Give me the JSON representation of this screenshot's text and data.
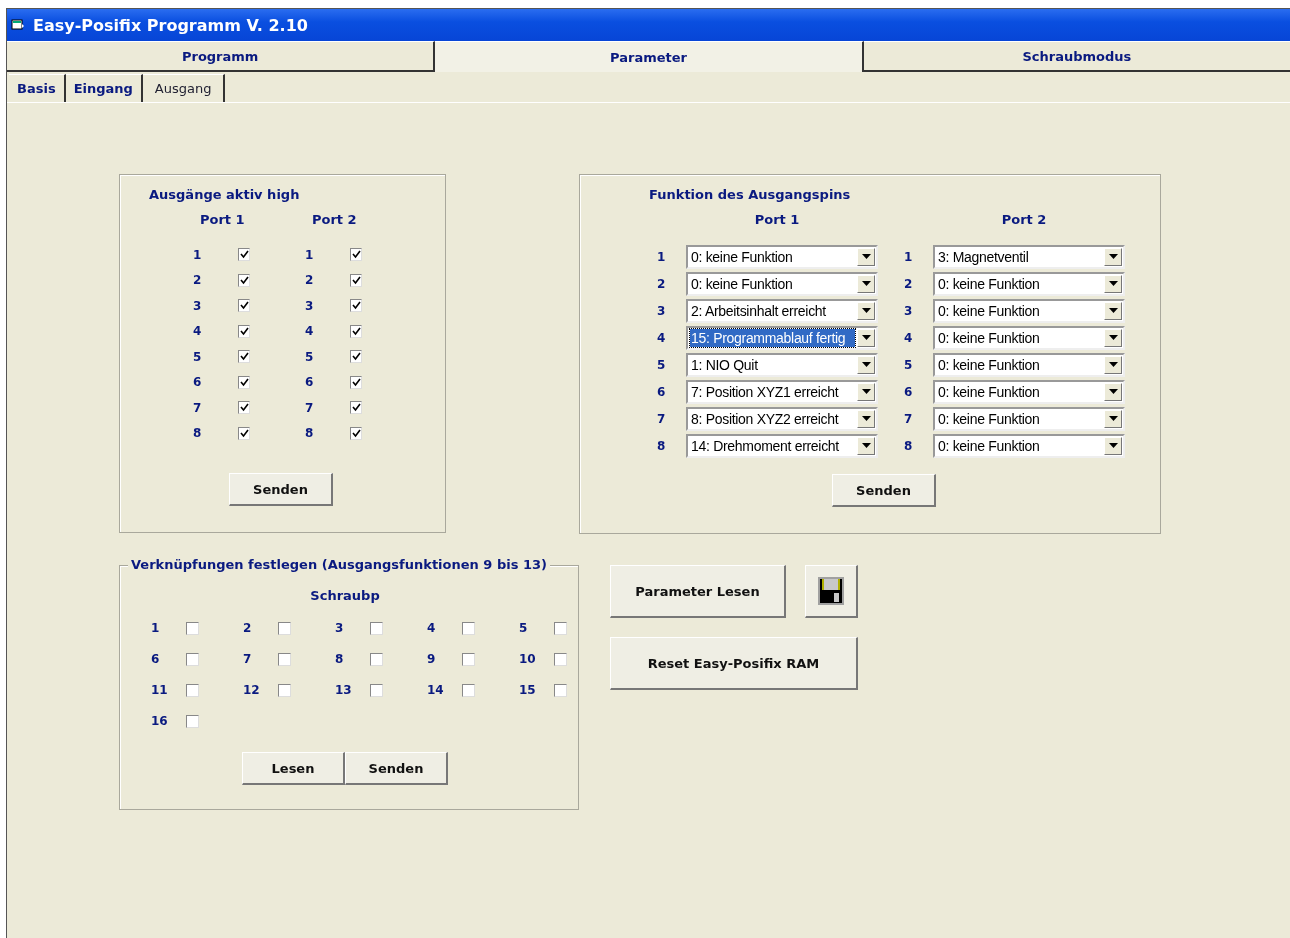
{
  "window": {
    "title": "Easy-Posifix Programm V. 2.10"
  },
  "main_tabs": [
    {
      "label": "Programm",
      "selected": false
    },
    {
      "label": "Parameter",
      "selected": true
    },
    {
      "label": "Schraubmodus",
      "selected": false
    }
  ],
  "sub_tabs": [
    {
      "label": "Basis",
      "selected": false
    },
    {
      "label": "Eingang",
      "selected": false
    },
    {
      "label": "Ausgang",
      "selected": true
    }
  ],
  "active_high": {
    "title": "Ausgänge aktiv high",
    "ports": [
      {
        "label": "Port 1",
        "pins": [
          {
            "number": "1",
            "checked": true
          },
          {
            "number": "2",
            "checked": true
          },
          {
            "number": "3",
            "checked": true
          },
          {
            "number": "4",
            "checked": true
          },
          {
            "number": "5",
            "checked": true
          },
          {
            "number": "6",
            "checked": true
          },
          {
            "number": "7",
            "checked": true
          },
          {
            "number": "8",
            "checked": true
          }
        ]
      },
      {
        "label": "Port 2",
        "pins": [
          {
            "number": "1",
            "checked": true
          },
          {
            "number": "2",
            "checked": true
          },
          {
            "number": "3",
            "checked": true
          },
          {
            "number": "4",
            "checked": true
          },
          {
            "number": "5",
            "checked": true
          },
          {
            "number": "6",
            "checked": true
          },
          {
            "number": "7",
            "checked": true
          },
          {
            "number": "8",
            "checked": true
          }
        ]
      }
    ],
    "send_button": "Senden"
  },
  "pin_functions": {
    "title": "Funktion des Ausgangspins",
    "ports": [
      {
        "label": "Port 1",
        "pins": [
          {
            "number": "1",
            "value": "0: keine Funktion",
            "selected": false
          },
          {
            "number": "2",
            "value": "0: keine Funktion",
            "selected": false
          },
          {
            "number": "3",
            "value": "2: Arbeitsinhalt erreicht",
            "selected": false
          },
          {
            "number": "4",
            "value": "15: Programmablauf fertig",
            "selected": true
          },
          {
            "number": "5",
            "value": "1: NIO Quit",
            "selected": false
          },
          {
            "number": "6",
            "value": "7: Position XYZ1 erreicht",
            "selected": false
          },
          {
            "number": "7",
            "value": "8: Position XYZ2 erreicht",
            "selected": false
          },
          {
            "number": "8",
            "value": "14: Drehmoment erreicht",
            "selected": false
          }
        ]
      },
      {
        "label": "Port 2",
        "pins": [
          {
            "number": "1",
            "value": "3: Magnetventil",
            "selected": false
          },
          {
            "number": "2",
            "value": "0: keine Funktion",
            "selected": false
          },
          {
            "number": "3",
            "value": "0: keine Funktion",
            "selected": false
          },
          {
            "number": "4",
            "value": "0: keine Funktion",
            "selected": false
          },
          {
            "number": "5",
            "value": "0: keine Funktion",
            "selected": false
          },
          {
            "number": "6",
            "value": "0: keine Funktion",
            "selected": false
          },
          {
            "number": "7",
            "value": "0: keine Funktion",
            "selected": false
          },
          {
            "number": "8",
            "value": "0: keine Funktion",
            "selected": false
          }
        ]
      }
    ],
    "send_button": "Senden"
  },
  "links": {
    "legend": "Verknüpfungen festlegen (Ausgangsfunktionen 9 bis 13)",
    "heading": "Schraubp",
    "items": [
      {
        "number": "1",
        "checked": false
      },
      {
        "number": "2",
        "checked": false
      },
      {
        "number": "3",
        "checked": false
      },
      {
        "number": "4",
        "checked": false
      },
      {
        "number": "5",
        "checked": false
      },
      {
        "number": "6",
        "checked": false
      },
      {
        "number": "7",
        "checked": false
      },
      {
        "number": "8",
        "checked": false
      },
      {
        "number": "9",
        "checked": false
      },
      {
        "number": "10",
        "checked": false
      },
      {
        "number": "11",
        "checked": false
      },
      {
        "number": "12",
        "checked": false
      },
      {
        "number": "13",
        "checked": false
      },
      {
        "number": "14",
        "checked": false
      },
      {
        "number": "15",
        "checked": false
      },
      {
        "number": "16",
        "checked": false
      }
    ],
    "buttons": [
      "Lesen",
      "Senden"
    ]
  },
  "actions": {
    "read_button": "Parameter Lesen",
    "reset_button": "Reset Easy-Posifix RAM"
  }
}
